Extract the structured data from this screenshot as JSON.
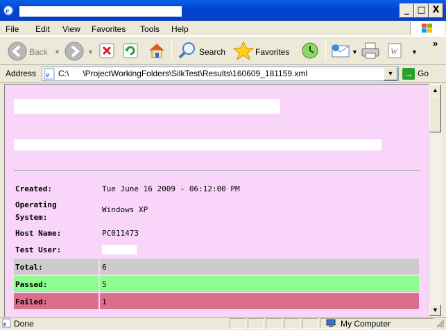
{
  "window": {
    "min_label": "_",
    "max_label": "□",
    "close_label": "X"
  },
  "menu": {
    "items": [
      "File",
      "Edit",
      "View",
      "Favorites",
      "Tools",
      "Help"
    ]
  },
  "toolbar": {
    "back_label": "Back",
    "search_label": "Search",
    "favorites_label": "Favorites",
    "chevron_label": "»"
  },
  "address": {
    "label": "Address",
    "value": "C:\\      \\ProjectWorkingFolders\\SilkTest\\Results\\160609_181159.xml",
    "go_label": "Go"
  },
  "report": {
    "rows": [
      {
        "label": "Created:",
        "value": "Tue June 16 2009 - 06:12:00 PM"
      },
      {
        "label": "Operating\nSystem:",
        "value": "Windows XP"
      },
      {
        "label": "Host Name:",
        "value": "PC011473"
      },
      {
        "label": "Test User:",
        "value": ""
      }
    ],
    "summary": [
      {
        "label": "Total:",
        "value": "6",
        "color": "#cdcbcd"
      },
      {
        "label": "Passed:",
        "value": "5",
        "color": "#8efc8e"
      },
      {
        "label": "Failed:",
        "value": "1",
        "color": "#da6e8c"
      }
    ]
  },
  "status": {
    "left_text": "Done",
    "zone_text": "My Computer"
  },
  "colors": {
    "page_bg": "#fad5fa",
    "titlebar": "#0a5ee8"
  }
}
